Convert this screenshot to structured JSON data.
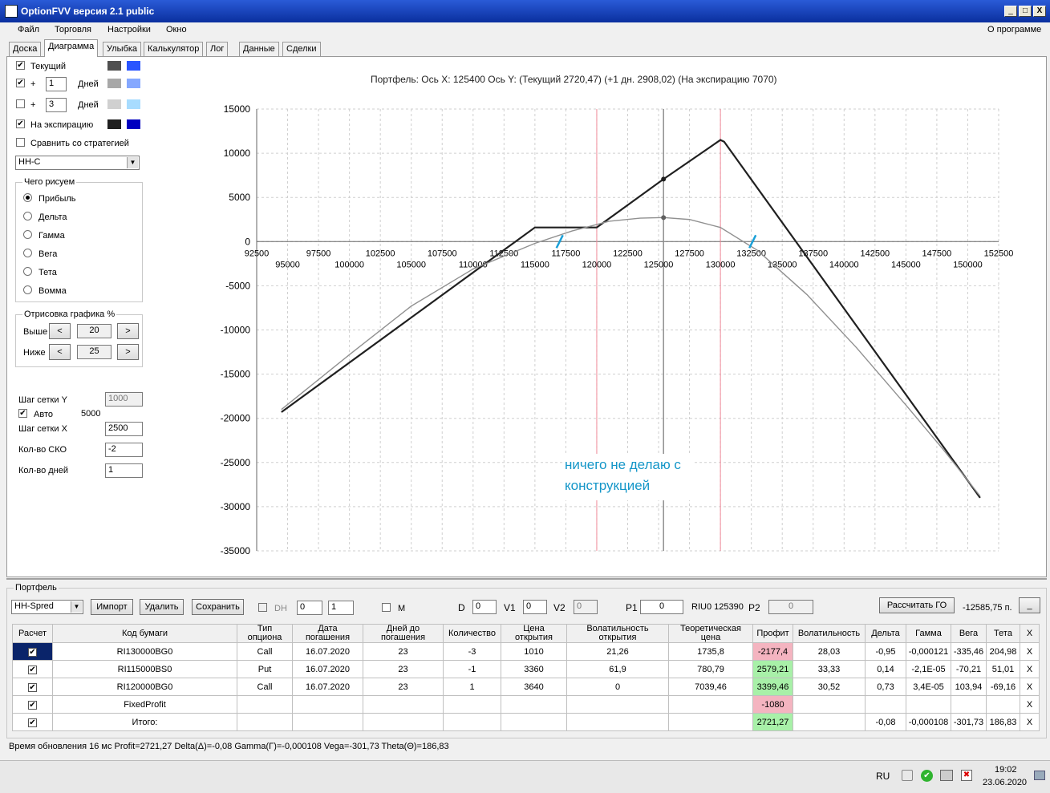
{
  "window": {
    "title": "OptionFVV версия 2.1 public",
    "minimize": "_",
    "maximize": "□",
    "close": "X"
  },
  "menu": {
    "items": [
      "Файл",
      "Торговля",
      "Настройки",
      "Окно"
    ],
    "about": "О программе"
  },
  "tabs": [
    "Доска",
    "Диаграмма",
    "Улыбка",
    "Калькулятор",
    "Лог",
    "Данные",
    "Сделки"
  ],
  "left": {
    "current": {
      "label": "Текущий",
      "checked": true
    },
    "plus1": {
      "plus": "+",
      "value": "1",
      "days": "Дней",
      "checked": true
    },
    "plus3": {
      "plus": "+",
      "value": "3",
      "days": "Дней",
      "checked": false
    },
    "expiry": {
      "label": "На экспирацию",
      "checked": true
    },
    "compare": {
      "label": "Сравнить со стратегией",
      "checked": false
    },
    "strategy_select": "НН-С",
    "draw_group": {
      "title": "Чего рисуем",
      "options": [
        "Прибыль",
        "Дельта",
        "Гамма",
        "Вега",
        "Тета",
        "Вомма"
      ],
      "selected": "Прибыль"
    },
    "render_group": {
      "title": "Отрисовка графика %",
      "above_label": "Выше",
      "above_value": "20",
      "below_label": "Ниже",
      "below_value": "25",
      "left_arrow": "<",
      "right_arrow": ">"
    },
    "grid_step_y": {
      "label": "Шаг сетки Y",
      "value": "1000"
    },
    "auto": {
      "label": "Авто",
      "checked": true,
      "value": "5000"
    },
    "grid_step_x": {
      "label": "Шаг сетки X",
      "value": "2500"
    },
    "sko": {
      "label": "Кол-во СКО",
      "value": "-2"
    },
    "days": {
      "label": "Кол-во дней",
      "value": "1"
    }
  },
  "colors": {
    "current_dark": "#505050",
    "current_light": "#2a55ff",
    "plus1_dark": "#a8a8a8",
    "plus1_light": "#85a8ff",
    "plus3_dark": "#d0d0d0",
    "plus3_light": "#a8dcff",
    "expiry_dark": "#202020",
    "expiry_light": "#0000c0"
  },
  "chart_data": {
    "type": "line",
    "title": "Портфель:  Ось X:  125400  Ось Y:   (Текущий 2720,47)   (+1 дн.  2908,02)   (На экспирацию  7070)",
    "xlim": [
      92500,
      152500
    ],
    "ylim": [
      -35000,
      15000
    ],
    "x_ticks_upper": [
      92500,
      97500,
      102500,
      107500,
      112500,
      117500,
      122500,
      127500,
      132500,
      137500,
      142500,
      147500,
      152500
    ],
    "x_ticks_lower": [
      95000,
      100000,
      105000,
      110000,
      115000,
      120000,
      125000,
      130000,
      135000,
      140000,
      145000,
      150000
    ],
    "y_ticks": [
      15000,
      10000,
      5000,
      0,
      -5000,
      -10000,
      -15000,
      -20000,
      -25000,
      -30000,
      -35000
    ],
    "current_x": 125400,
    "pink_lines": [
      120000,
      130000
    ],
    "series": [
      {
        "x": [
          94500,
          115000,
          120000,
          125400,
          130000,
          130300,
          151000
        ],
        "y": [
          -19300,
          1600,
          1600,
          7070,
          11500,
          11300,
          -29000
        ]
      },
      {
        "x": [
          94500,
          100000,
          105000,
          110000,
          115000,
          118000,
          121000,
          123500,
          125400,
          127500,
          130000,
          133000,
          137000,
          141000,
          145000,
          148000,
          151000
        ],
        "y": [
          -19000,
          -12800,
          -7300,
          -3100,
          -200,
          1200,
          2300,
          2650,
          2720,
          2500,
          1600,
          -1000,
          -6000,
          -12000,
          -18500,
          -23500,
          -28800
        ]
      }
    ],
    "sd_marks": [
      117000,
      132600
    ]
  },
  "note": {
    "line1": "ничего не делаю с",
    "line2": "конструкцией"
  },
  "portfolio": {
    "title": "Портфель",
    "select": "НН-Spred",
    "import": "Импорт",
    "delete": "Удалить",
    "save": "Сохранить",
    "dh_label": "DH",
    "dh_v1": "0",
    "dh_v2": "1",
    "m_label": "М",
    "d_label": "D",
    "d_value": "0",
    "v1_label": "V1",
    "v1_value": "0",
    "v2_label": "V2",
    "v2_value": "0",
    "p1_label": "P1",
    "p1_value": "0",
    "riu": "RIU0 125390",
    "p2_label": "P2",
    "p2_value": "0",
    "calc_go": "Рассчитать ГО",
    "go_value": "-12585,75 п.",
    "collapse": "_"
  },
  "table": {
    "headers": [
      "Расчет",
      "Код бумаги",
      "Тип\nопциона",
      "Дата\nпогашения",
      "Дней до\nпогашения",
      "Количество",
      "Цена\nоткрытия",
      "Волатильность\nоткрытия",
      "Теоретическая\nцена",
      "Профит",
      "Волатильность",
      "Дельта",
      "Гамма",
      "Вега",
      "Тета",
      "X"
    ],
    "rows": [
      {
        "code": "RI130000BG0",
        "type": "Call",
        "date": "16.07.2020",
        "days": "23",
        "qty": "-3",
        "price": "1010",
        "vol_open": "21,26",
        "theo": "1735,8",
        "profit": "-2177,4",
        "profit_style": "pink",
        "vol": "28,03",
        "delta": "-0,95",
        "gamma": "-0,000121",
        "vega": "-335,46",
        "theta": "204,98"
      },
      {
        "code": "RI115000BS0",
        "type": "Put",
        "date": "16.07.2020",
        "days": "23",
        "qty": "-1",
        "price": "3360",
        "vol_open": "61,9",
        "theo": "780,79",
        "profit": "2579,21",
        "profit_style": "green",
        "vol": "33,33",
        "delta": "0,14",
        "gamma": "-2,1E-05",
        "vega": "-70,21",
        "theta": "51,01"
      },
      {
        "code": "RI120000BG0",
        "type": "Call",
        "date": "16.07.2020",
        "days": "23",
        "qty": "1",
        "price": "3640",
        "vol_open": "0",
        "theo": "7039,46",
        "profit": "3399,46",
        "profit_style": "green",
        "vol": "30,52",
        "delta": "0,73",
        "gamma": "3,4E-05",
        "vega": "103,94",
        "theta": "-69,16"
      },
      {
        "code": "FixedProfit",
        "type": "",
        "date": "",
        "days": "",
        "qty": "",
        "price": "",
        "vol_open": "",
        "theo": "",
        "profit": "-1080",
        "profit_style": "pink",
        "vol": "",
        "delta": "",
        "gamma": "",
        "vega": "",
        "theta": ""
      },
      {
        "code": "Итого:",
        "type": "",
        "date": "",
        "days": "",
        "qty": "",
        "price": "",
        "vol_open": "",
        "theo": "",
        "profit": "2721,27",
        "profit_style": "green",
        "vol": "",
        "delta": "-0,08",
        "gamma": "-0,000108",
        "vega": "-301,73",
        "theta": "186,83"
      }
    ]
  },
  "status": "Время обновления 16 мс  Profit=2721,27 Delta(Δ)=-0,08 Gamma(Γ)=-0,000108 Vega=-301,73 Theta(Θ)=186,83",
  "taskbar": {
    "lang": "RU",
    "time": "19:02",
    "date": "23.06.2020"
  }
}
